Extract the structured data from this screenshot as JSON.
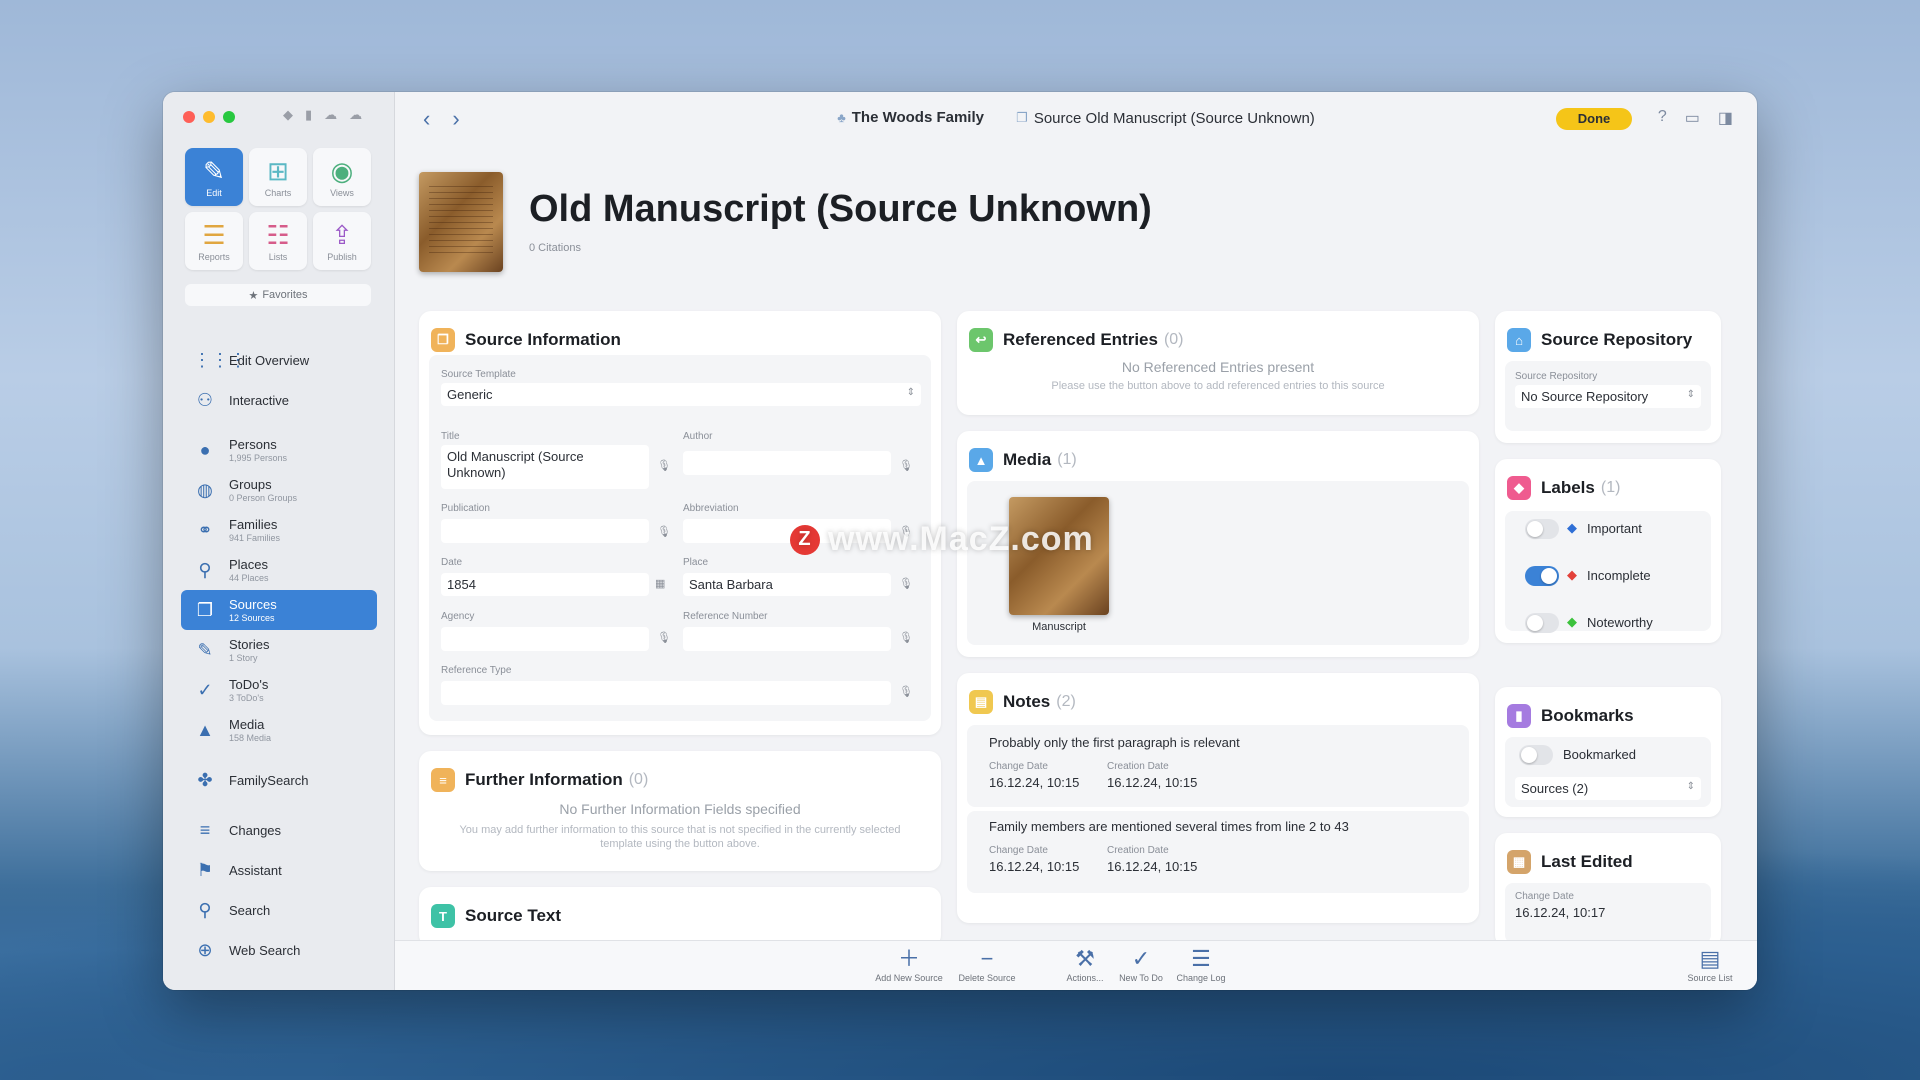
{
  "sidebar": {
    "modes": [
      {
        "label": "Edit",
        "icon": "pencil-icon",
        "glyph": "✎",
        "color": "#ffffff",
        "active": true
      },
      {
        "label": "Charts",
        "icon": "tree-chart-icon",
        "glyph": "⊞",
        "color": "#5bb8c4"
      },
      {
        "label": "Views",
        "icon": "eye-icon",
        "glyph": "◉",
        "color": "#4caf7d"
      },
      {
        "label": "Reports",
        "icon": "report-icon",
        "glyph": "☰",
        "color": "#e0a640"
      },
      {
        "label": "Lists",
        "icon": "list-icon",
        "glyph": "☷",
        "color": "#d65c8a"
      },
      {
        "label": "Publish",
        "icon": "upload-icon",
        "glyph": "⇪",
        "color": "#9b59c7"
      }
    ],
    "favorites_label": "Favorites",
    "nav": [
      {
        "label": "Edit Overview",
        "sub": "",
        "icon": "grid-icon",
        "glyph": "⋮⋮⋮"
      },
      {
        "label": "Interactive",
        "sub": "",
        "icon": "interactive-tree-icon",
        "glyph": "⚇"
      },
      {
        "label": "Persons",
        "sub": "1,995 Persons",
        "icon": "person-icon",
        "glyph": "●"
      },
      {
        "label": "Groups",
        "sub": "0 Person Groups",
        "icon": "groups-icon",
        "glyph": "◍"
      },
      {
        "label": "Families",
        "sub": "941 Families",
        "icon": "families-icon",
        "glyph": "⚭"
      },
      {
        "label": "Places",
        "sub": "44 Places",
        "icon": "pin-icon",
        "glyph": "⚲"
      },
      {
        "label": "Sources",
        "sub": "12 Sources",
        "icon": "sources-icon",
        "glyph": "❐",
        "active": true
      },
      {
        "label": "Stories",
        "sub": "1 Story",
        "icon": "stories-icon",
        "glyph": "✎"
      },
      {
        "label": "ToDo's",
        "sub": "3 ToDo's",
        "icon": "todo-icon",
        "glyph": "✓"
      },
      {
        "label": "Media",
        "sub": "158 Media",
        "icon": "media-icon",
        "glyph": "▲"
      },
      {
        "label": "FamilySearch",
        "sub": "",
        "icon": "familysearch-icon",
        "glyph": "✤"
      },
      {
        "label": "Changes",
        "sub": "",
        "icon": "changes-icon",
        "glyph": "≡"
      },
      {
        "label": "Assistant",
        "sub": "",
        "icon": "assistant-icon",
        "glyph": "⚑"
      },
      {
        "label": "Search",
        "sub": "",
        "icon": "search-icon",
        "glyph": "⚲"
      },
      {
        "label": "Web Search",
        "sub": "",
        "icon": "web-search-icon",
        "glyph": "⊕"
      }
    ]
  },
  "titlebar": {
    "crumb_family": "The Woods Family",
    "crumb_source": "Source Old Manuscript (Source Unknown)",
    "done_label": "Done"
  },
  "header": {
    "title": "Old Manuscript (Source Unknown)",
    "subtitle": "0 Citations"
  },
  "source_info": {
    "title": "Source Information",
    "template_label": "Source Template",
    "template_value": "Generic",
    "title_label": "Title",
    "title_value": "Old Manuscript (Source Unknown)",
    "author_label": "Author",
    "publication_label": "Publication",
    "abbreviation_label": "Abbreviation",
    "date_label": "Date",
    "date_value": "1854",
    "place_label": "Place",
    "place_value": "Santa Barbara",
    "agency_label": "Agency",
    "refnum_label": "Reference Number",
    "reftype_label": "Reference Type"
  },
  "further_info": {
    "title": "Further Information",
    "count": "(0)",
    "empty_title": "No Further Information Fields specified",
    "empty_sub": "You may add further information to this source that is not specified in the currently selected template using the button above."
  },
  "source_text": {
    "title": "Source Text"
  },
  "referenced": {
    "title": "Referenced Entries",
    "count": "(0)",
    "empty_title": "No Referenced Entries present",
    "empty_sub": "Please use the button above to add referenced entries to this source"
  },
  "media": {
    "title": "Media",
    "count": "(1)",
    "item_label": "Manuscript"
  },
  "notes": {
    "title": "Notes",
    "count": "(2)",
    "change_label": "Change Date",
    "creation_label": "Creation Date",
    "items": [
      {
        "text": "Probably only the first paragraph is relevant",
        "change": "16.12.24, 10:15",
        "creation": "16.12.24, 10:15"
      },
      {
        "text": "Family members are mentioned several times from line 2 to 43",
        "change": "16.12.24, 10:15",
        "creation": "16.12.24, 10:15"
      }
    ]
  },
  "repository": {
    "title": "Source Repository",
    "field_label": "Source Repository",
    "field_value": "No Source Repository"
  },
  "labels": {
    "title": "Labels",
    "count": "(1)",
    "items": [
      {
        "label": "Important",
        "on": false,
        "color": "#2f6fd6"
      },
      {
        "label": "Incomplete",
        "on": true,
        "color": "#e2413a"
      },
      {
        "label": "Noteworthy",
        "on": false,
        "color": "#3cc23c"
      }
    ]
  },
  "bookmarks": {
    "title": "Bookmarks",
    "toggle_label": "Bookmarked",
    "select_value": "Sources (2)"
  },
  "last_edited": {
    "title": "Last Edited",
    "change_label": "Change Date",
    "change_value": "16.12.24, 10:17"
  },
  "toolbar": {
    "add_label": "Add New Source",
    "delete_label": "Delete Source",
    "actions_label": "Actions...",
    "todo_label": "New To Do",
    "changelog_label": "Change Log",
    "sourcelist_label": "Source List"
  },
  "watermark": "www.MacZ.com",
  "watermark_badge": "Z",
  "colors": {
    "accent": "#3b82d6",
    "done": "#f5c518"
  }
}
